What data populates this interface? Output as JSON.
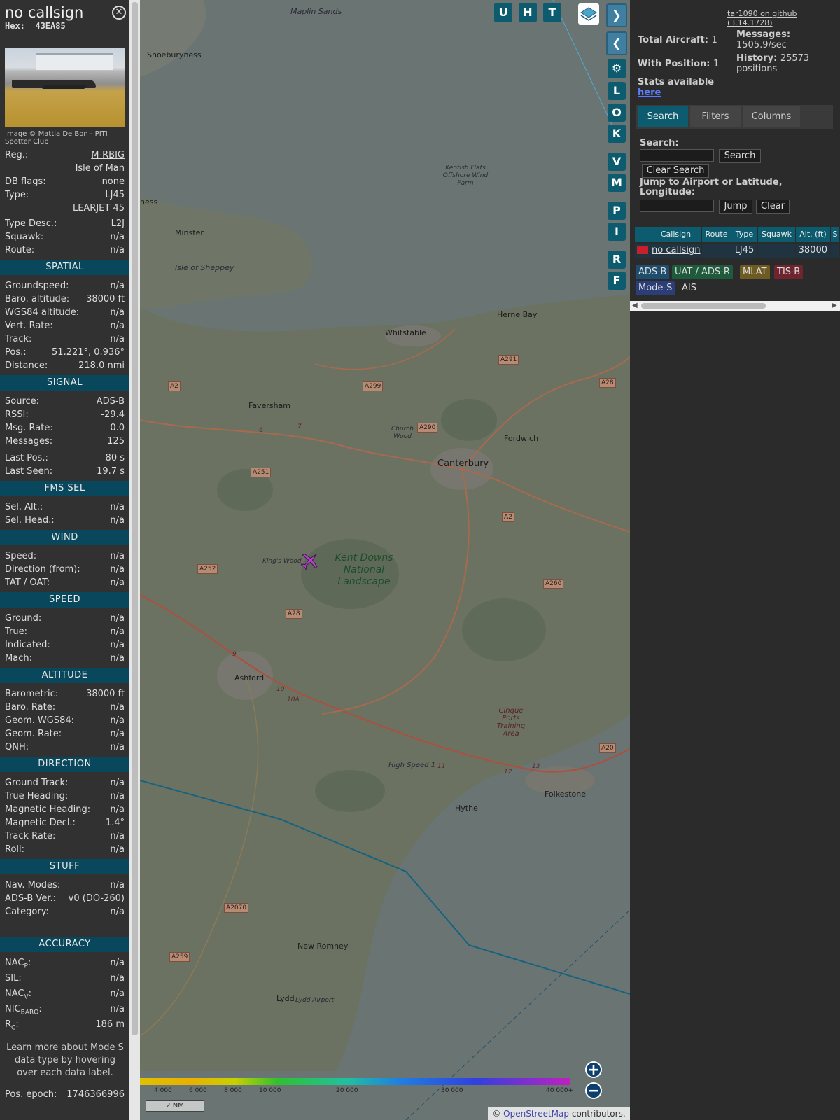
{
  "infobox": {
    "callsign": "no callsign",
    "hex_label": "Hex:",
    "hex": "43EA85",
    "close_icon": "close-icon",
    "photo_credit": "Image © Mattia De Bon - PITI Spotter Club",
    "rows_top": [
      {
        "label": "Reg.:",
        "value": "M-RBIG",
        "link": true
      },
      {
        "label": "",
        "value": "Isle of Man"
      },
      {
        "label": "DB flags:",
        "value": "none"
      },
      {
        "label": "Type:",
        "value": "LJ45"
      },
      {
        "label": "",
        "value": "LEARJET 45"
      }
    ],
    "rows_top2": [
      {
        "label": "Type Desc.:",
        "value": "L2J"
      },
      {
        "label": "Squawk:",
        "value": "n/a"
      },
      {
        "label": "Route:",
        "value": "n/a"
      }
    ],
    "spatial_title": "SPATIAL",
    "spatial": [
      {
        "label": "Groundspeed:",
        "value": "n/a"
      },
      {
        "label": "Baro. altitude:",
        "value": "38000 ft"
      },
      {
        "label": "WGS84 altitude:",
        "value": "n/a"
      },
      {
        "label": "Vert. Rate:",
        "value": "n/a"
      },
      {
        "label": "Track:",
        "value": "n/a"
      },
      {
        "label": "Pos.:",
        "value": "51.221°, 0.936°"
      },
      {
        "label": "Distance:",
        "value": "218.0 nmi"
      }
    ],
    "signal_title": "SIGNAL",
    "signal": [
      {
        "label": "Source:",
        "value": "ADS-B"
      },
      {
        "label": "RSSI:",
        "value": "-29.4"
      },
      {
        "label": "Msg. Rate:",
        "value": "0.0"
      },
      {
        "label": "Messages:",
        "value": "125"
      }
    ],
    "signal2": [
      {
        "label": "Last Pos.:",
        "value": "80 s"
      },
      {
        "label": "Last Seen:",
        "value": "19.7 s"
      }
    ],
    "fms_title": "FMS SEL",
    "fms": [
      {
        "label": "Sel. Alt.:",
        "value": "n/a"
      },
      {
        "label": "Sel. Head.:",
        "value": "n/a"
      }
    ],
    "wind_title": "WIND",
    "wind": [
      {
        "label": "Speed:",
        "value": "n/a"
      },
      {
        "label": "Direction (from):",
        "value": "n/a"
      },
      {
        "label": "TAT / OAT:",
        "value": "n/a"
      }
    ],
    "speed_title": "SPEED",
    "speed": [
      {
        "label": "Ground:",
        "value": "n/a"
      },
      {
        "label": "True:",
        "value": "n/a"
      },
      {
        "label": "Indicated:",
        "value": "n/a"
      },
      {
        "label": "Mach:",
        "value": "n/a"
      }
    ],
    "altitude_title": "ALTITUDE",
    "altitude": [
      {
        "label": "Barometric:",
        "value": "38000 ft"
      },
      {
        "label": "Baro. Rate:",
        "value": "n/a"
      },
      {
        "label": "Geom. WGS84:",
        "value": "n/a"
      },
      {
        "label": "Geom. Rate:",
        "value": "n/a"
      },
      {
        "label": "QNH:",
        "value": "n/a"
      }
    ],
    "direction_title": "DIRECTION",
    "direction": [
      {
        "label": "Ground Track:",
        "value": "n/a"
      },
      {
        "label": "True Heading:",
        "value": "n/a"
      },
      {
        "label": "Magnetic Heading:",
        "value": "n/a"
      },
      {
        "label": "Magnetic Decl.:",
        "value": "1.4°"
      },
      {
        "label": "Track Rate:",
        "value": "n/a"
      },
      {
        "label": "Roll:",
        "value": "n/a"
      }
    ],
    "stuff_title": "STUFF",
    "stuff": [
      {
        "label": "Nav. Modes:",
        "value": "n/a"
      },
      {
        "label": "ADS-B Ver.:",
        "value": "v0 (DO-260)"
      },
      {
        "label": "Category:",
        "value": "n/a"
      }
    ],
    "accuracy_title": "ACCURACY",
    "accuracy": [
      {
        "label": "NAC",
        "sub": "P",
        "value": "n/a"
      },
      {
        "label": "SIL:",
        "sub": "",
        "value": "n/a"
      },
      {
        "label": "NAC",
        "sub": "V",
        "value": "n/a"
      },
      {
        "label": "NIC",
        "sub": "BARO",
        "value": "n/a"
      },
      {
        "label": "R",
        "sub": "C",
        "value": "186 m"
      }
    ],
    "learn_more": "Learn more about Mode S data type by hovering over each data label.",
    "pos_epoch_label": "Pos. epoch:",
    "pos_epoch": "1746366996"
  },
  "map": {
    "buttons_top": [
      "U",
      "H",
      "T"
    ],
    "buttons_side": [
      "L",
      "O",
      "K",
      "V",
      "M",
      "P",
      "I",
      "R",
      "F"
    ],
    "places": [
      "Maplin Sands",
      "Shoeburyness",
      "ness",
      "Minster",
      "Isle of Sheppey",
      "Kentish Flats Offshore Wind Farm",
      "Herne Bay",
      "Whitstable",
      "Faversham",
      "Church Wood",
      "Fordwich",
      "Canterbury",
      "King's Wood",
      "Kent Downs National Landscape",
      "Ashford",
      "Cinque Ports Training Area",
      "High Speed 1",
      "Hythe",
      "Folkestone",
      "New Romney",
      "Lydd",
      "Lydd Airport"
    ],
    "roads": [
      "A2",
      "A299",
      "A291",
      "A28",
      "A290",
      "A251",
      "A2",
      "A252",
      "A28",
      "A260",
      "A20",
      "A2070",
      "A259"
    ],
    "junctions": [
      "6",
      "7",
      "9",
      "10",
      "10A",
      "11",
      "12",
      "13"
    ],
    "colorbar_labels": [
      "4 000",
      "6 000",
      "8 000",
      "10 000",
      "20 000",
      "30 000",
      "40 000+"
    ],
    "scale": "2 NM",
    "attribution_prefix": "©",
    "attribution_link": "OpenStreetMap",
    "attribution_suffix": "contributors."
  },
  "sidebar": {
    "github": "tar1090 on github (3.14.1728)",
    "total_aircraft_label": "Total Aircraft:",
    "total_aircraft": "1",
    "with_position_label": "With Position:",
    "with_position": "1",
    "stats_available": "Stats available",
    "stats_link": "here",
    "messages_label": "Messages:",
    "messages": "1505.9/sec",
    "history_label": "History:",
    "history": "25573 positions",
    "tabs": [
      "Search",
      "Filters",
      "Columns"
    ],
    "search_label": "Search:",
    "search_button": "Search",
    "clear_search_button": "Clear Search",
    "jump_label": "Jump to Airport or Latitude, Longitude:",
    "jump_button": "Jump",
    "clear_button": "Clear",
    "table_headers": [
      "Callsign",
      "Route",
      "Type",
      "Squawk",
      "Alt. (ft)",
      "S"
    ],
    "table_row": {
      "callsign": "no callsign",
      "route": "",
      "type": "LJ45",
      "squawk": "",
      "alt": "38000"
    },
    "badges": [
      "ADS-B",
      "UAT / ADS-R",
      "MLAT",
      "TIS-B",
      "Mode-S",
      "AIS"
    ]
  },
  "colors": {
    "section": "#08475c",
    "accent": "#0c5b6e",
    "aircraft": "#b543c7",
    "adsb": "#1e4d6e",
    "uat": "#1f5a3c",
    "mlat": "#6e5a23",
    "tisb": "#6e2530",
    "modes": "#2c3e78"
  }
}
